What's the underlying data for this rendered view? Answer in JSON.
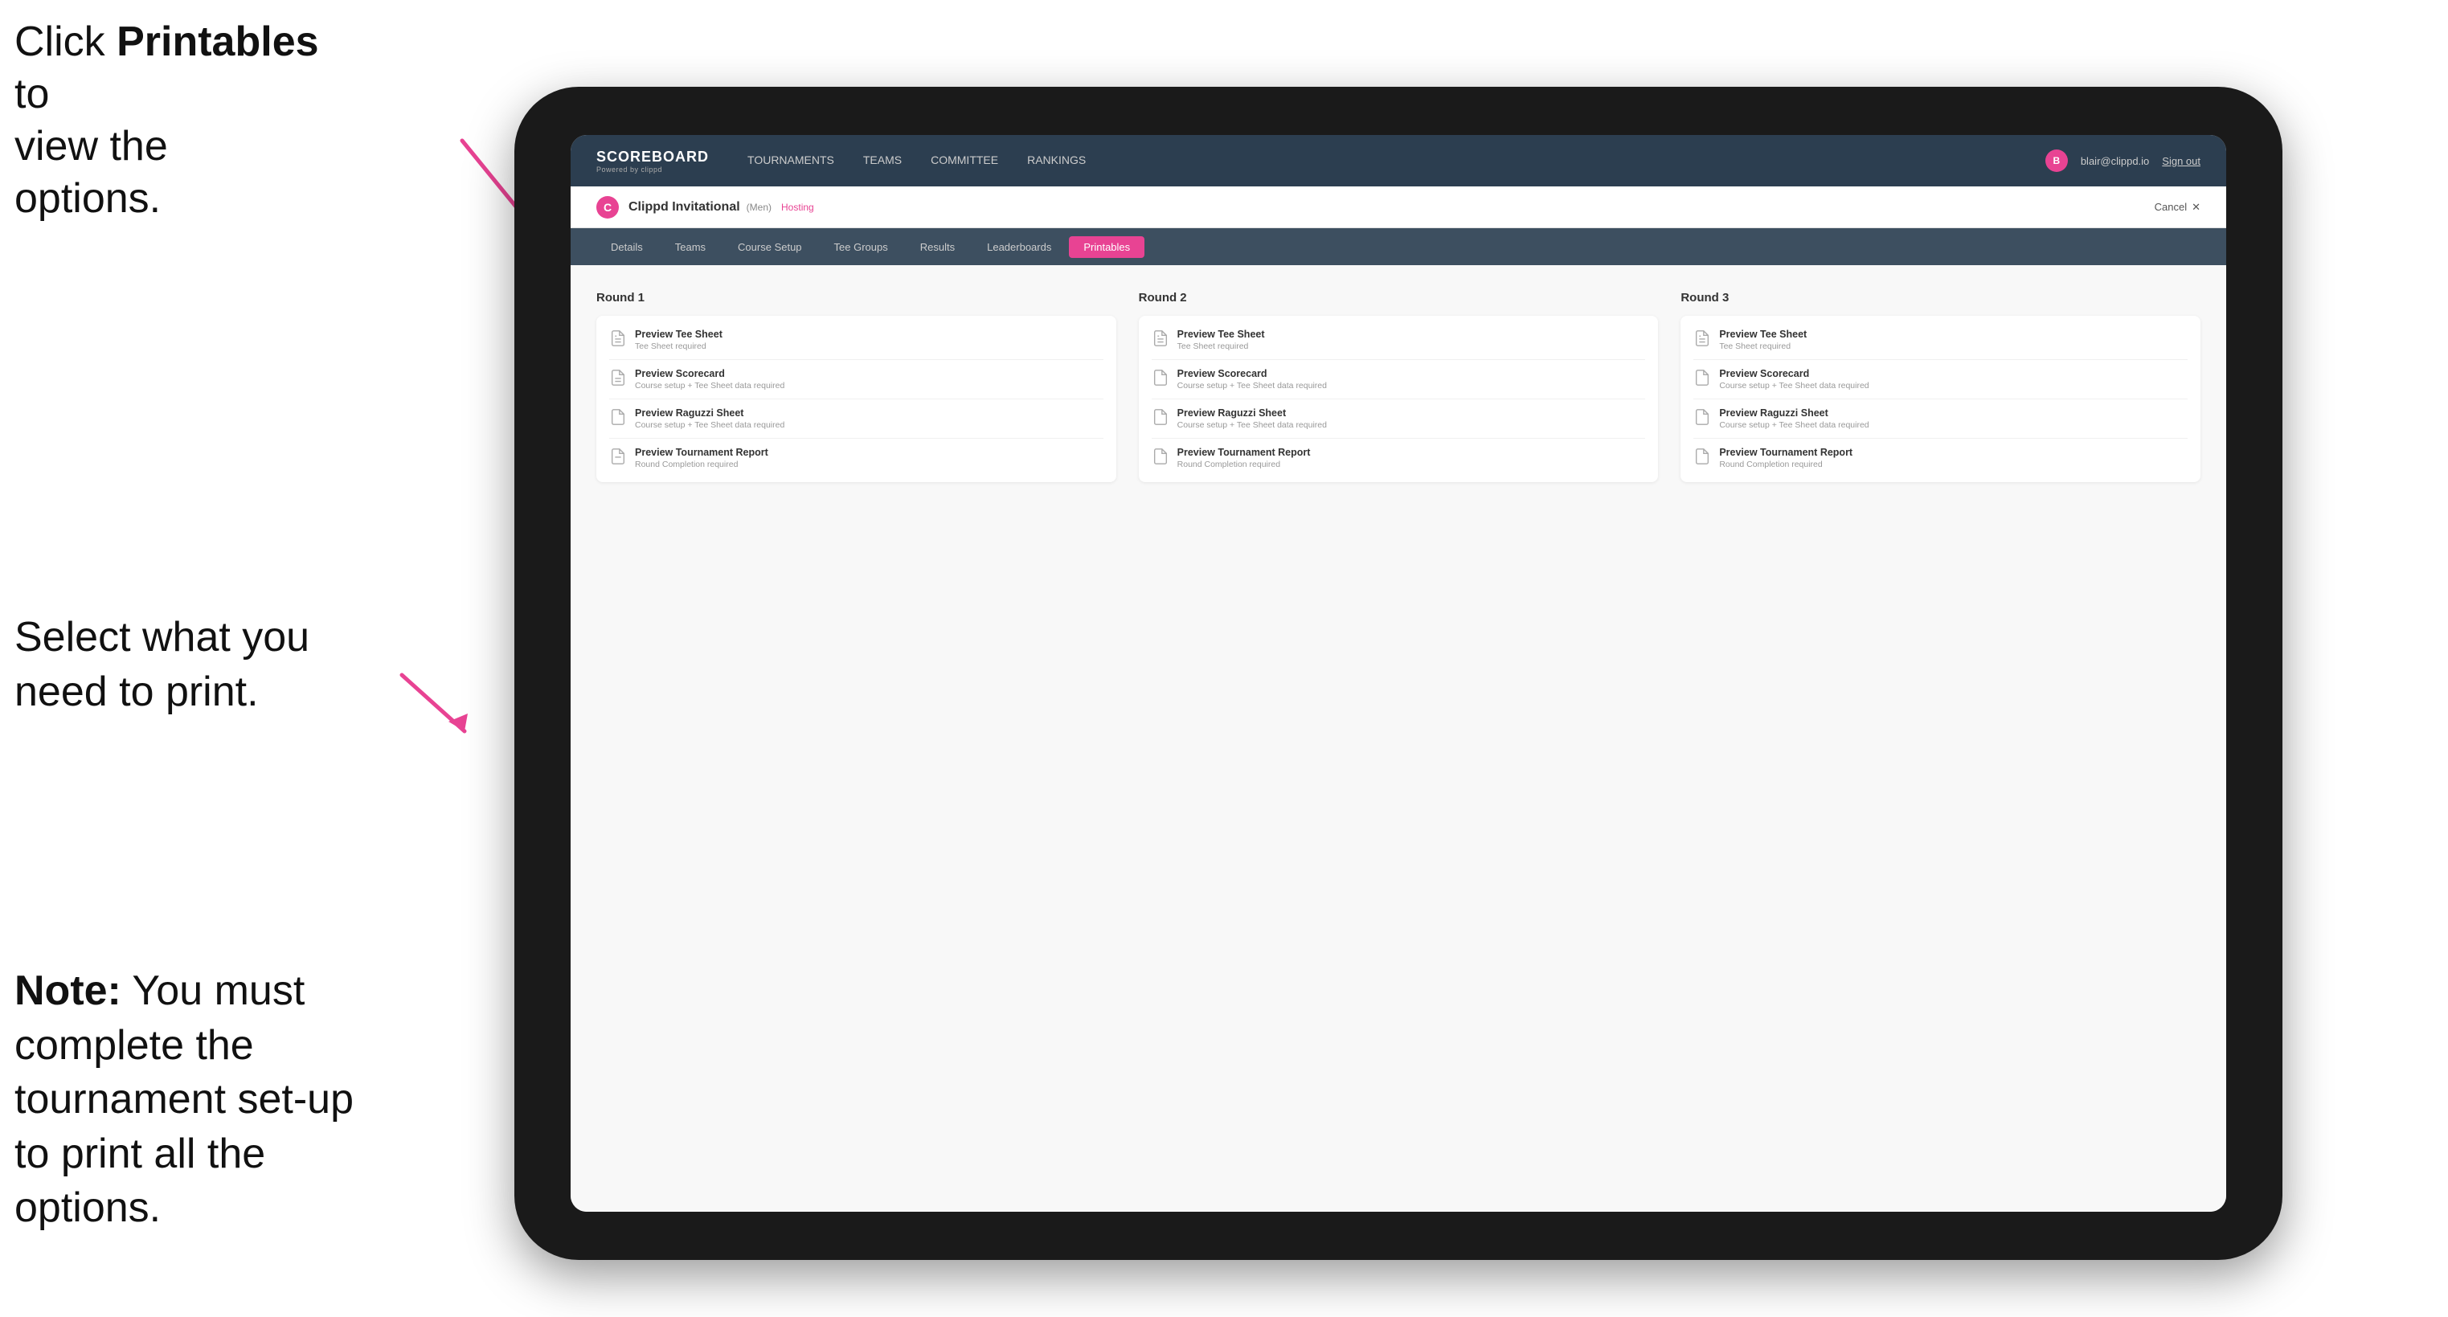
{
  "annotations": {
    "top": {
      "line1": "Click ",
      "bold": "Printables",
      "line2": " to",
      "line3": "view the options."
    },
    "middle": {
      "text": "Select what you need to print."
    },
    "bottom": {
      "note_bold": "Note:",
      "note_text": " You must complete the tournament set-up to print all the options."
    }
  },
  "top_nav": {
    "logo_title": "SCOREBOARD",
    "logo_subtitle": "Powered by clippd",
    "links": [
      {
        "label": "TOURNAMENTS",
        "active": false
      },
      {
        "label": "TEAMS",
        "active": false
      },
      {
        "label": "COMMITTEE",
        "active": false
      },
      {
        "label": "RANKINGS",
        "active": false
      }
    ],
    "user_email": "blair@clippd.io",
    "sign_out": "Sign out",
    "user_initial": "B"
  },
  "tournament_bar": {
    "logo_letter": "C",
    "name": "Clippd Invitational",
    "badge": "(Men)",
    "status": "Hosting",
    "cancel": "Cancel",
    "close": "✕"
  },
  "sub_tabs": [
    {
      "label": "Details",
      "active": false
    },
    {
      "label": "Teams",
      "active": false
    },
    {
      "label": "Course Setup",
      "active": false
    },
    {
      "label": "Tee Groups",
      "active": false
    },
    {
      "label": "Results",
      "active": false
    },
    {
      "label": "Leaderboards",
      "active": false
    },
    {
      "label": "Printables",
      "active": true
    }
  ],
  "rounds": [
    {
      "title": "Round 1",
      "items": [
        {
          "title": "Preview Tee Sheet",
          "subtitle": "Tee Sheet required"
        },
        {
          "title": "Preview Scorecard",
          "subtitle": "Course setup + Tee Sheet data required"
        },
        {
          "title": "Preview Raguzzi Sheet",
          "subtitle": "Course setup + Tee Sheet data required"
        },
        {
          "title": "Preview Tournament Report",
          "subtitle": "Round Completion required"
        }
      ]
    },
    {
      "title": "Round 2",
      "items": [
        {
          "title": "Preview Tee Sheet",
          "subtitle": "Tee Sheet required"
        },
        {
          "title": "Preview Scorecard",
          "subtitle": "Course setup + Tee Sheet data required"
        },
        {
          "title": "Preview Raguzzi Sheet",
          "subtitle": "Course setup + Tee Sheet data required"
        },
        {
          "title": "Preview Tournament Report",
          "subtitle": "Round Completion required"
        }
      ]
    },
    {
      "title": "Round 3",
      "items": [
        {
          "title": "Preview Tee Sheet",
          "subtitle": "Tee Sheet required"
        },
        {
          "title": "Preview Scorecard",
          "subtitle": "Course setup + Tee Sheet data required"
        },
        {
          "title": "Preview Raguzzi Sheet",
          "subtitle": "Course setup + Tee Sheet data required"
        },
        {
          "title": "Preview Tournament Report",
          "subtitle": "Round Completion required"
        }
      ]
    }
  ]
}
